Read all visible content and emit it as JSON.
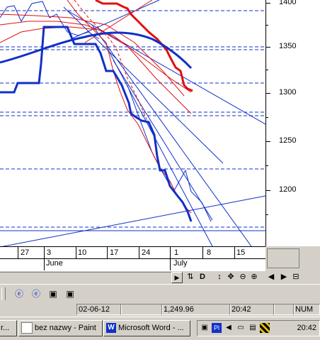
{
  "chart": {
    "y_labels": [
      "1400",
      "1350",
      "1300",
      "1250",
      "1200"
    ],
    "x_days": [
      "27",
      "3",
      "10",
      "17",
      "24",
      "1",
      "8",
      "15"
    ],
    "x_months": [
      "June",
      "July"
    ]
  },
  "toolbar": {
    "icons": [
      "redraw-icon",
      "d-icon",
      "updown-icon",
      "move-icon",
      "zoom-out-icon",
      "zoom-in-icon",
      "left-arrow-icon",
      "right-arrow-icon",
      "grid-icon"
    ],
    "d_label": "D"
  },
  "statusbar": {
    "date": "02-06-12",
    "value": "1,249.96",
    "time": "20:42",
    "mode": "NUM"
  },
  "taskbar": {
    "items": [
      {
        "label": "r..."
      },
      {
        "label": "bez nazwy - Paint"
      },
      {
        "label": "Microsoft Word - ..."
      }
    ],
    "clock": "20:42",
    "tray_pl": "Pl"
  },
  "colors": {
    "chart_blue": "#1030c8",
    "chart_red": "#e01010",
    "panel": "#d4d0c8"
  }
}
